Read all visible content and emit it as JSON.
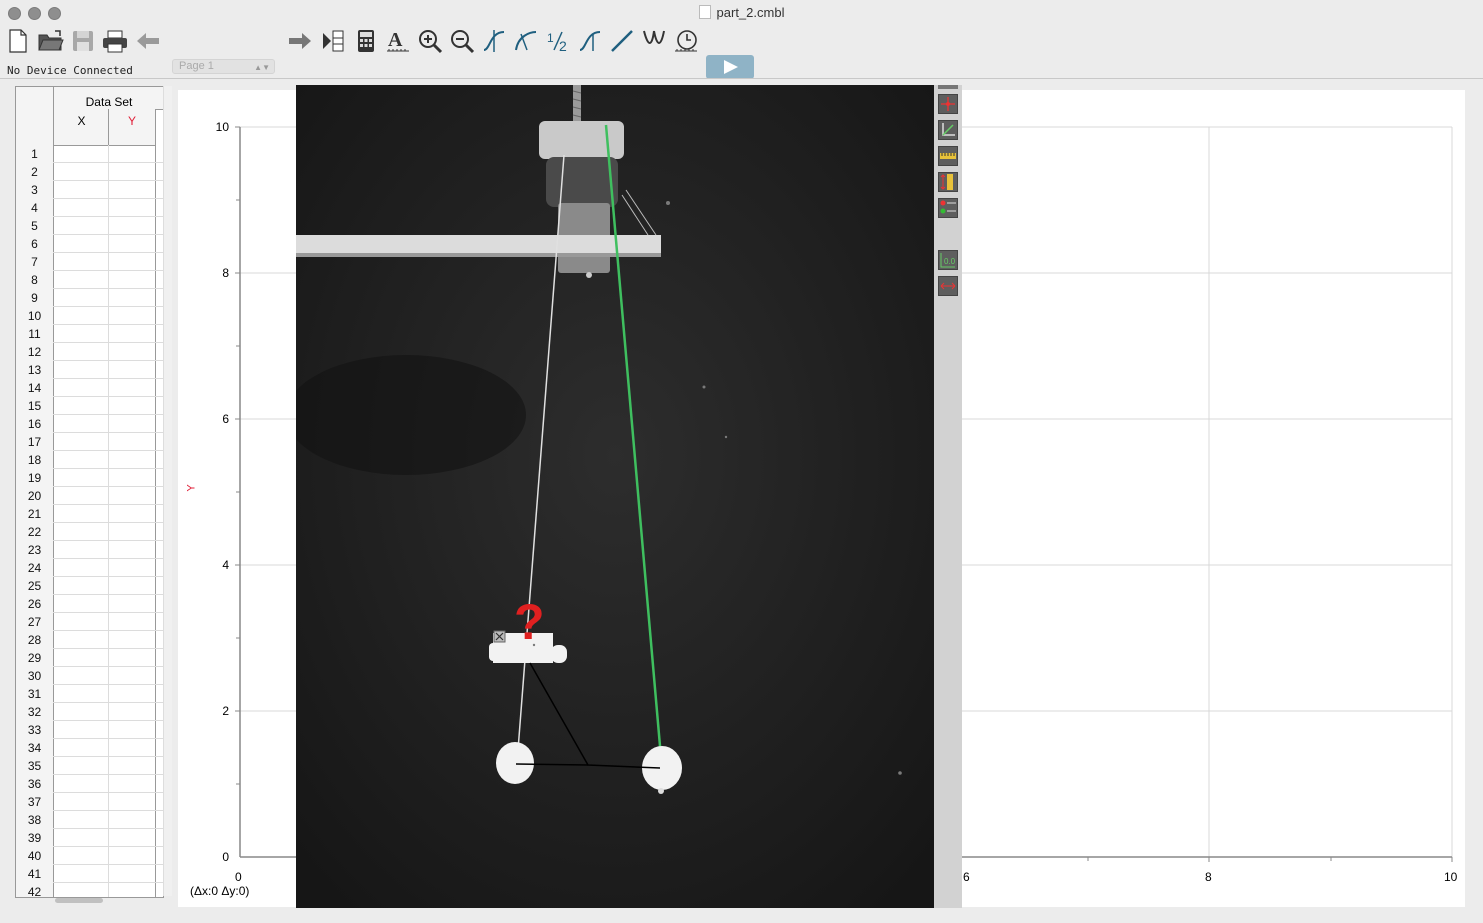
{
  "window": {
    "title": "part_2.cmbl"
  },
  "toolbar": {
    "page_select": "Page 1",
    "icons": [
      "new-file-icon",
      "open-folder-icon",
      "save-icon",
      "print-icon",
      "back-arrow-icon",
      "forward-arrow-icon",
      "page-layout-icon",
      "calculator-icon",
      "text-annotation-icon",
      "zoom-in-icon",
      "zoom-out-icon",
      "examine-icon",
      "tangent-icon",
      "integral-icon",
      "stats-icon",
      "curve-fit-icon",
      "linear-fit-icon",
      "model-icon",
      "timer-icon",
      "play-icon"
    ]
  },
  "status": {
    "device": "No Device Connected"
  },
  "table": {
    "dataset": "Data Set",
    "col_x": "X",
    "col_y": "Y",
    "rows": [
      "1",
      "2",
      "3",
      "4",
      "5",
      "6",
      "7",
      "8",
      "9",
      "10",
      "11",
      "12",
      "13",
      "14",
      "15",
      "16",
      "17",
      "18",
      "19",
      "20",
      "21",
      "22",
      "23",
      "24",
      "25",
      "26",
      "27",
      "28",
      "29",
      "30",
      "31",
      "32",
      "33",
      "34",
      "35",
      "36",
      "37",
      "38",
      "39",
      "40",
      "41",
      "42"
    ]
  },
  "graph": {
    "y_label": "Y",
    "y_ticks": [
      "10",
      "8",
      "6",
      "4",
      "2",
      "0"
    ],
    "x_tick_left": "0",
    "x_ticks_right": [
      "6",
      "8",
      "10"
    ],
    "delta_readout": "(Δx:0 Δy:0)",
    "annotation_mark": "?",
    "colors": {
      "axis_label": "#e0213a",
      "trace": "#3fbf5f"
    }
  }
}
